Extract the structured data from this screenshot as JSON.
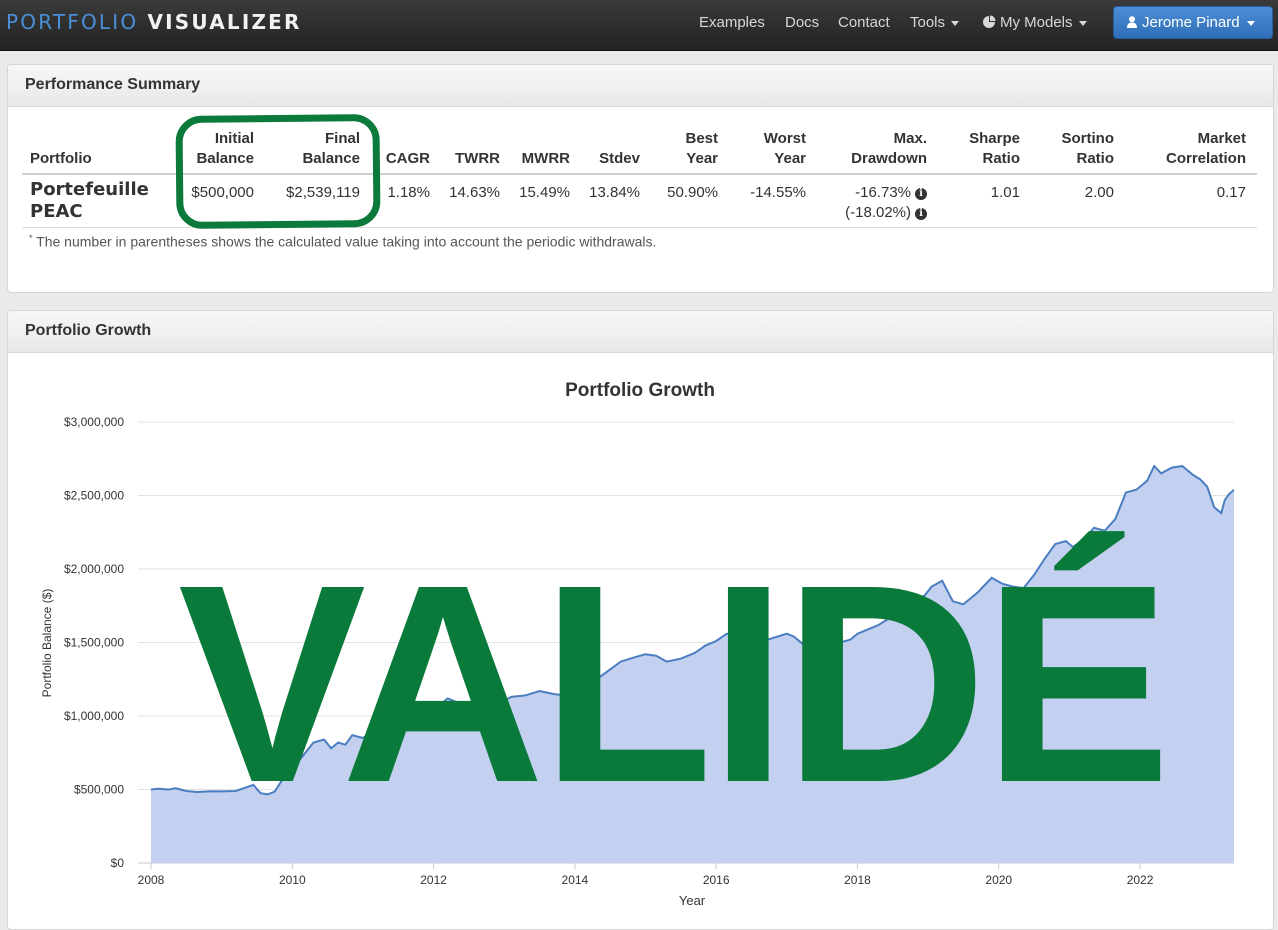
{
  "navbar": {
    "brand_part1": "PORTFOLIO",
    "brand_part2": "VISUALIZER",
    "links": [
      "Examples",
      "Docs",
      "Contact",
      "Tools",
      "My Models"
    ],
    "user": "Jerome Pinard"
  },
  "summary": {
    "title": "Performance Summary",
    "headers": {
      "portfolio": "Portfolio",
      "initial_1": "Initial",
      "initial_2": "Balance",
      "final_1": "Final",
      "final_2": "Balance",
      "cagr": "CAGR",
      "twrr": "TWRR",
      "mwrr": "MWRR",
      "stdev": "Stdev",
      "best_1": "Best",
      "best_2": "Year",
      "worst_1": "Worst",
      "worst_2": "Year",
      "mdd_1": "Max.",
      "mdd_2": "Drawdown",
      "sharpe_1": "Sharpe",
      "sharpe_2": "Ratio",
      "sortino_1": "Sortino",
      "sortino_2": "Ratio",
      "corr_1": "Market",
      "corr_2": "Correlation"
    },
    "row": {
      "name_1": "Portefeuille",
      "name_2": "PEAC",
      "initial": "$500,000",
      "final": "$2,539,119",
      "cagr": "1.18%",
      "twrr": "14.63%",
      "mwrr": "15.49%",
      "stdev": "13.84%",
      "best": "50.90%",
      "worst": "-14.55%",
      "mdd": "-16.73%",
      "mdd_adj": "(-18.02%)",
      "sharpe": "1.01",
      "sortino": "2.00",
      "corr": "0.17"
    },
    "footnote_mark": "*",
    "footnote": "The number in parentheses shows the calculated value taking into account the periodic withdrawals."
  },
  "growth": {
    "title": "Portfolio Growth"
  },
  "stamp": {
    "text": "VALIDÉ",
    "color": "#0a7a3a"
  },
  "colors": {
    "line": "#4a7ec0",
    "area": "#c3d0f0",
    "stamp": "#0a7a3a",
    "primary": "#3478c6"
  },
  "chart_data": {
    "type": "area",
    "title": "Portfolio Growth",
    "xlabel": "Year",
    "ylabel": "Portfolio Balance ($)",
    "xlim": [
      2008,
      2023.33
    ],
    "ylim": [
      0,
      3000000
    ],
    "x_ticks": [
      "2008",
      "2010",
      "2012",
      "2014",
      "2016",
      "2018",
      "2020",
      "2022"
    ],
    "y_ticks": [
      "$0",
      "$500,000",
      "$1,000,000",
      "$1,500,000",
      "$2,000,000",
      "$2,500,000",
      "$3,000,000"
    ],
    "grid": true,
    "series": [
      {
        "points": [
          [
            2008.0,
            500000
          ],
          [
            2008.1,
            505000
          ],
          [
            2008.25,
            500000
          ],
          [
            2008.35,
            508000
          ],
          [
            2008.5,
            490000
          ],
          [
            2008.65,
            483000
          ],
          [
            2008.85,
            488000
          ],
          [
            2009.0,
            487000
          ],
          [
            2009.2,
            490000
          ],
          [
            2009.35,
            515000
          ],
          [
            2009.45,
            531000
          ],
          [
            2009.55,
            475000
          ],
          [
            2009.65,
            467000
          ],
          [
            2009.75,
            485000
          ],
          [
            2009.85,
            560000
          ],
          [
            2010.0,
            640000
          ],
          [
            2010.15,
            730000
          ],
          [
            2010.3,
            820000
          ],
          [
            2010.45,
            840000
          ],
          [
            2010.55,
            780000
          ],
          [
            2010.65,
            820000
          ],
          [
            2010.75,
            805000
          ],
          [
            2010.85,
            870000
          ],
          [
            2011.0,
            850000
          ],
          [
            2011.1,
            880000
          ],
          [
            2011.3,
            840000
          ],
          [
            2011.5,
            880000
          ],
          [
            2011.7,
            930000
          ],
          [
            2011.9,
            1000000
          ],
          [
            2012.1,
            1080000
          ],
          [
            2012.2,
            1120000
          ],
          [
            2012.35,
            1090000
          ],
          [
            2012.5,
            1040000
          ],
          [
            2012.7,
            1060000
          ],
          [
            2012.9,
            1080000
          ],
          [
            2013.1,
            1130000
          ],
          [
            2013.3,
            1140000
          ],
          [
            2013.5,
            1170000
          ],
          [
            2013.7,
            1150000
          ],
          [
            2013.85,
            1140000
          ],
          [
            2014.0,
            1160000
          ],
          [
            2014.25,
            1230000
          ],
          [
            2014.45,
            1300000
          ],
          [
            2014.65,
            1370000
          ],
          [
            2014.85,
            1400000
          ],
          [
            2015.0,
            1420000
          ],
          [
            2015.15,
            1410000
          ],
          [
            2015.3,
            1370000
          ],
          [
            2015.5,
            1390000
          ],
          [
            2015.7,
            1430000
          ],
          [
            2015.85,
            1480000
          ],
          [
            2016.0,
            1510000
          ],
          [
            2016.15,
            1560000
          ],
          [
            2016.3,
            1540000
          ],
          [
            2016.45,
            1470000
          ],
          [
            2016.6,
            1500000
          ],
          [
            2016.8,
            1530000
          ],
          [
            2017.0,
            1560000
          ],
          [
            2017.1,
            1540000
          ],
          [
            2017.25,
            1480000
          ],
          [
            2017.45,
            1470000
          ],
          [
            2017.6,
            1460000
          ],
          [
            2017.75,
            1500000
          ],
          [
            2017.9,
            1520000
          ],
          [
            2018.0,
            1560000
          ],
          [
            2018.15,
            1590000
          ],
          [
            2018.3,
            1620000
          ],
          [
            2018.5,
            1680000
          ],
          [
            2018.65,
            1740000
          ],
          [
            2018.8,
            1790000
          ],
          [
            2018.95,
            1820000
          ],
          [
            2019.05,
            1880000
          ],
          [
            2019.2,
            1920000
          ],
          [
            2019.35,
            1780000
          ],
          [
            2019.5,
            1760000
          ],
          [
            2019.7,
            1840000
          ],
          [
            2019.9,
            1940000
          ],
          [
            2020.05,
            1900000
          ],
          [
            2020.2,
            1880000
          ],
          [
            2020.35,
            1870000
          ],
          [
            2020.5,
            1960000
          ],
          [
            2020.65,
            2070000
          ],
          [
            2020.8,
            2170000
          ],
          [
            2020.95,
            2190000
          ],
          [
            2021.05,
            2150000
          ],
          [
            2021.2,
            2200000
          ],
          [
            2021.35,
            2280000
          ],
          [
            2021.5,
            2260000
          ],
          [
            2021.65,
            2340000
          ],
          [
            2021.8,
            2520000
          ],
          [
            2021.95,
            2540000
          ],
          [
            2022.1,
            2600000
          ],
          [
            2022.2,
            2700000
          ],
          [
            2022.3,
            2650000
          ],
          [
            2022.45,
            2690000
          ],
          [
            2022.6,
            2700000
          ],
          [
            2022.75,
            2640000
          ],
          [
            2022.85,
            2610000
          ],
          [
            2022.95,
            2560000
          ],
          [
            2023.05,
            2420000
          ],
          [
            2023.15,
            2380000
          ],
          [
            2023.2,
            2470000
          ],
          [
            2023.26,
            2510000
          ],
          [
            2023.33,
            2539119
          ]
        ]
      }
    ]
  }
}
